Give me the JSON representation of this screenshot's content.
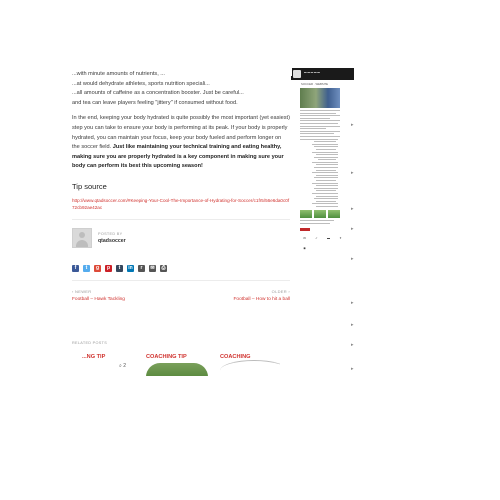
{
  "article": {
    "para1_line1": "...with minute amounts of nutrients, ...",
    "para1_line2": "...at would dehydrate athletes, sports nutrition speciali...",
    "para1_line3": "...all amounts of caffeine as a concentration booster. Just be careful...",
    "para1_line4": "and tea can leave players feeling \"jittery\" if consumed without food.",
    "para2_text": "In the end, keeping your body hydrated is quite possibly the most important (yet easiest) step you can take to ensure your body is performing at its peak.  If your body is properly hydrated, you can maintain your focus, keep your body fueled and perform longer on the soccer field. ",
    "para2_bold": "Just like maintaining your technical training and eating healthy, making sure you are properly hydrated is a key component in making sure your body can perform its best this upcoming season!",
    "tip_heading": "Tip source",
    "tip_link": "http://www.qtadsoccer.com/#Keeping-Your-Cool-The-Importance-of-Hydrating-for-Soccer/c1fr5/56e6da0c0f72cb92ae42ac"
  },
  "author": {
    "posted_by": "POSTED BY",
    "name": "qtadsoccer"
  },
  "share": {
    "icons": [
      "facebook-icon",
      "twitter-icon",
      "google-plus-icon",
      "pinterest-icon",
      "tumblr-icon",
      "linkedin-icon",
      "reddit-icon",
      "email-icon",
      "print-icon"
    ],
    "colors": [
      "#3b5998",
      "#55acee",
      "#dd4b39",
      "#cb2027",
      "#35465c",
      "#0077b5",
      "#555555",
      "#555555",
      "#555555"
    ],
    "glyphs": [
      "f",
      "t",
      "g",
      "p",
      "t",
      "in",
      "r",
      "✉",
      "⎙"
    ]
  },
  "post_nav": {
    "prev_label": "NEWER",
    "prev_title": "Football – Hawk Tackling",
    "next_label": "OLDER",
    "next_title": "Football – How to hit a ball"
  },
  "related": {
    "label": "RELATED POSTS",
    "card1_title": "...NG TIP",
    "card2_title": "COACHING TIP",
    "card3_title": "COACHING"
  },
  "sidebar": {
    "title": "SOCCER · WEBSITE"
  },
  "colors": {
    "accent": "#d0312d",
    "text": "#333333"
  }
}
